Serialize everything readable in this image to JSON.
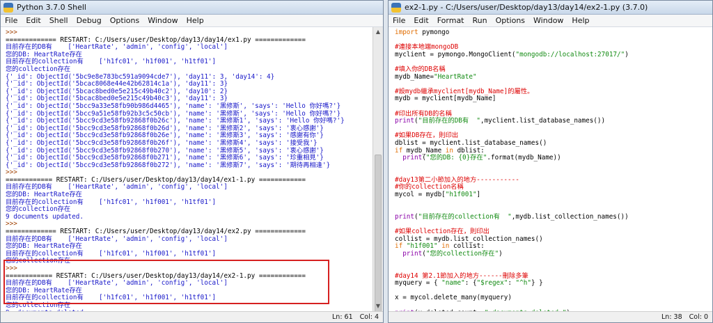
{
  "shell": {
    "title": "Python 3.7.0 Shell",
    "menu": [
      "File",
      "Edit",
      "Shell",
      "Debug",
      "Options",
      "Window",
      "Help"
    ],
    "lines": [
      {
        "c": "prompt",
        "t": ">>>"
      },
      {
        "c": "txt",
        "t": "============= RESTART: C:/Users/user/Desktop/day13/day14/ex1.py ============="
      },
      {
        "c": "out",
        "t": "目前存在的DB有    ['HeartRate', 'admin', 'config', 'local']"
      },
      {
        "c": "out",
        "t": "您的DB: HeartRate存在"
      },
      {
        "c": "out",
        "t": "目前存在的collection有    ['h1fc01', 'h1f001', 'h1tf01']"
      },
      {
        "c": "out",
        "t": "您的collection存在"
      },
      {
        "c": "out",
        "t": "{'_id': ObjectId('5bc9e8e783bc591a9094cde7'), 'day11': 3, 'day14': 4}"
      },
      {
        "c": "out",
        "t": "{'_id': ObjectId('5bcac8068e44e42b62814c1a'), 'day11': 3}"
      },
      {
        "c": "out",
        "t": "{'_id': ObjectId('5bcac8bed0e5e215c49b40c2'), 'day10': 2}"
      },
      {
        "c": "out",
        "t": "{'_id': ObjectId('5bcac8bed0e5e215c49b40c3'), 'day11': 3}"
      },
      {
        "c": "out",
        "t": "{'_id': ObjectId('5bcc9a33e58fb90b986d4465'), 'name': '黑修斯', 'says': 'Hello 你好嗎?'}"
      },
      {
        "c": "out",
        "t": "{'_id': ObjectId('5bcc9a51e58fb92b3c5c50cb'), 'name': '黑修斯', 'says': 'Hello 你好嗎?'}"
      },
      {
        "c": "out",
        "t": "{'_id': ObjectId('5bcc9cd3e58fb92868f0b26c'), 'name': '黑修斯1', 'says': 'Hello 你好嗎?'}"
      },
      {
        "c": "out",
        "t": "{'_id': ObjectId('5bcc9cd3e58fb92868f0b26d'), 'name': '黑修斯2', 'says': '衷心感謝'}"
      },
      {
        "c": "out",
        "t": "{'_id': ObjectId('5bcc9cd3e58fb92868f0b26e'), 'name': '黑修斯3', 'says': '感謝有你'}"
      },
      {
        "c": "out",
        "t": "{'_id': ObjectId('5bcc9cd3e58fb92868f0b26f'), 'name': '黑修斯4', 'says': '接受我'}"
      },
      {
        "c": "out",
        "t": "{'_id': ObjectId('5bcc9cd3e58fb92868f0b270'), 'name': '黑修斯5', 'says': '衷心感謝'}"
      },
      {
        "c": "out",
        "t": "{'_id': ObjectId('5bcc9cd3e58fb92868f0b271'), 'name': '黑修斯6', 'says': '珍重相見'}"
      },
      {
        "c": "out",
        "t": "{'_id': ObjectId('5bcc9cd3e58fb92868f0b272'), 'name': '黑修斯7', 'says': '期待再相逢'}"
      },
      {
        "c": "prompt",
        "t": ">>>"
      },
      {
        "c": "txt",
        "t": "============ RESTART: C:/Users/user/Desktop/day13/day14/ex1-1.py ============"
      },
      {
        "c": "out",
        "t": "目前存在的DB有    ['HeartRate', 'admin', 'config', 'local']"
      },
      {
        "c": "out",
        "t": "您的DB: HeartRate存在"
      },
      {
        "c": "out",
        "t": "目前存在的collection有    ['h1fc01', 'h1f001', 'h1tf01']"
      },
      {
        "c": "out",
        "t": "您的collection存在"
      },
      {
        "c": "out",
        "t": "9 documents updated."
      },
      {
        "c": "prompt",
        "t": ">>>"
      },
      {
        "c": "txt",
        "t": "============= RESTART: C:/Users/user/Desktop/day13/day14/ex2.py ============="
      },
      {
        "c": "out",
        "t": "目前存在的DB有    ['HeartRate', 'admin', 'config', 'local']"
      },
      {
        "c": "out",
        "t": "您的DB: HeartRate存在"
      },
      {
        "c": "out",
        "t": "目前存在的collection有    ['h1fc01', 'h1f001', 'h1tf01']"
      },
      {
        "c": "out",
        "t": "您的collection存在"
      },
      {
        "c": "prompt",
        "t": ">>>"
      },
      {
        "c": "txt",
        "t": "============ RESTART: C:/Users/user/Desktop/day13/day14/ex2-1.py ============"
      },
      {
        "c": "out",
        "t": "目前存在的DB有    ['HeartRate', 'admin', 'config', 'local']"
      },
      {
        "c": "out",
        "t": "您的DB: HeartRate存在"
      },
      {
        "c": "out",
        "t": "目前存在的collection有    ['h1fc01', 'h1f001', 'h1tf01']"
      },
      {
        "c": "out",
        "t": "您的collection存在"
      },
      {
        "c": "out",
        "t": "9  documents deleted."
      },
      {
        "c": "prompt",
        "t": ">>>"
      }
    ],
    "status": {
      "line": "Ln: 61",
      "col": "Col: 4"
    }
  },
  "editor": {
    "title": "ex2-1.py - C:/Users/user/Desktop/day13/day14/ex2-1.py (3.7.0)",
    "menu": [
      "File",
      "Edit",
      "Format",
      "Run",
      "Options",
      "Window",
      "Help"
    ],
    "lines": [
      [
        {
          "c": "kw",
          "t": "import"
        },
        {
          "c": "txt",
          "t": " pymongo"
        }
      ],
      [],
      [
        {
          "c": "cm",
          "t": "#連接本地端mongoDB"
        }
      ],
      [
        {
          "c": "txt",
          "t": "myclient = pymongo.MongoClient("
        },
        {
          "c": "st",
          "t": "\"mongodb://localhost:27017/\""
        },
        {
          "c": "txt",
          "t": ")"
        }
      ],
      [],
      [
        {
          "c": "cm",
          "t": "#填入你的DB名稱"
        }
      ],
      [
        {
          "c": "txt",
          "t": "mydb_Name="
        },
        {
          "c": "st",
          "t": "\"HeartRate\""
        }
      ],
      [],
      [
        {
          "c": "cm",
          "t": "#設mydb繼承myclient[mydb_Name]的屬性。"
        }
      ],
      [
        {
          "c": "txt",
          "t": "mydb = myclient[mydb_Name]"
        }
      ],
      [],
      [
        {
          "c": "cm",
          "t": "#印出所有DB的名稱"
        }
      ],
      [
        {
          "c": "bi",
          "t": "print"
        },
        {
          "c": "txt",
          "t": "("
        },
        {
          "c": "st",
          "t": "\"目前存在的DB有  \""
        },
        {
          "c": "txt",
          "t": ",myclient.list_database_names())"
        }
      ],
      [],
      [
        {
          "c": "cm",
          "t": "#如果DB存在，則印出"
        }
      ],
      [
        {
          "c": "txt",
          "t": "dblist = myclient.list_database_names()"
        }
      ],
      [
        {
          "c": "kw",
          "t": "if"
        },
        {
          "c": "txt",
          "t": " mydb_Name "
        },
        {
          "c": "kw",
          "t": "in"
        },
        {
          "c": "txt",
          "t": " dblist:"
        }
      ],
      [
        {
          "c": "txt",
          "t": "  "
        },
        {
          "c": "bi",
          "t": "print"
        },
        {
          "c": "txt",
          "t": "("
        },
        {
          "c": "st",
          "t": "\"您的DB: {0}存在\""
        },
        {
          "c": "txt",
          "t": ".format(mydb_Name))"
        }
      ],
      [],
      [],
      [
        {
          "c": "cm",
          "t": "#day13第二小節加入的地方-----------"
        }
      ],
      [
        {
          "c": "cm",
          "t": "#你的collection名稱"
        }
      ],
      [
        {
          "c": "txt",
          "t": "mycol = mydb["
        },
        {
          "c": "st",
          "t": "\"h1f001\""
        },
        {
          "c": "txt",
          "t": "]"
        }
      ],
      [],
      [],
      [
        {
          "c": "bi",
          "t": "print"
        },
        {
          "c": "txt",
          "t": "("
        },
        {
          "c": "st",
          "t": "\"目前存在的collection有  \""
        },
        {
          "c": "txt",
          "t": ",mydb.list_collection_names())"
        }
      ],
      [],
      [
        {
          "c": "cm",
          "t": "#如果collection存在，則印出"
        }
      ],
      [
        {
          "c": "txt",
          "t": "collist = mydb.list_collection_names()"
        }
      ],
      [
        {
          "c": "kw",
          "t": "if"
        },
        {
          "c": "txt",
          "t": " "
        },
        {
          "c": "st",
          "t": "\"h1f001\""
        },
        {
          "c": "txt",
          "t": " "
        },
        {
          "c": "kw",
          "t": "in"
        },
        {
          "c": "txt",
          "t": " collist:"
        }
      ],
      [
        {
          "c": "txt",
          "t": "  "
        },
        {
          "c": "bi",
          "t": "print"
        },
        {
          "c": "txt",
          "t": "("
        },
        {
          "c": "st",
          "t": "\"您的collection存在\""
        },
        {
          "c": "txt",
          "t": ")"
        }
      ],
      [],
      [],
      [
        {
          "c": "cm",
          "t": "#day14 第2.1節加入的地方------刪除多筆"
        }
      ],
      [
        {
          "c": "txt",
          "t": "myquery = { "
        },
        {
          "c": "st",
          "t": "\"name\""
        },
        {
          "c": "txt",
          "t": ": {"
        },
        {
          "c": "st",
          "t": "\"$regex\""
        },
        {
          "c": "txt",
          "t": ": "
        },
        {
          "c": "st",
          "t": "\"^h\""
        },
        {
          "c": "txt",
          "t": "} }"
        }
      ],
      [],
      [
        {
          "c": "txt",
          "t": "x = mycol.delete_many(myquery)"
        }
      ],
      [],
      [
        {
          "c": "bi",
          "t": "print"
        },
        {
          "c": "txt",
          "t": "(x.deleted_count, "
        },
        {
          "c": "st",
          "t": "\" documents deleted.\""
        },
        {
          "c": "txt",
          "t": ")"
        }
      ]
    ],
    "status": {
      "line": "Ln: 38",
      "col": "Col: 0"
    }
  }
}
